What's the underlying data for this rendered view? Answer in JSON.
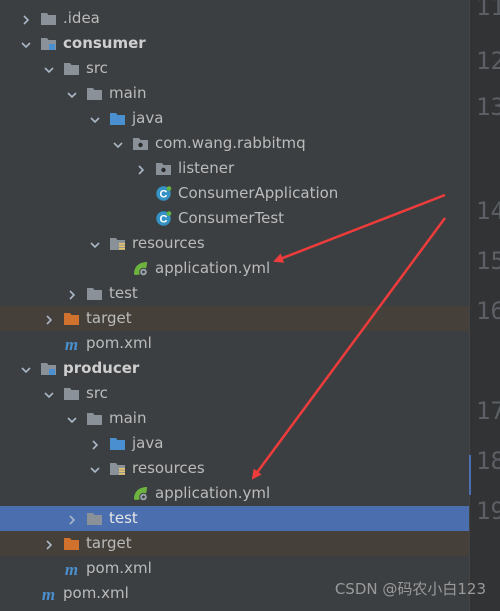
{
  "tree": [
    {
      "label": ".idea",
      "depth": 1,
      "arrow": "right",
      "icon": "folder-icon",
      "bold": false
    },
    {
      "label": "consumer",
      "depth": 1,
      "arrow": "down",
      "icon": "module-folder-icon",
      "bold": true
    },
    {
      "label": "src",
      "depth": 2,
      "arrow": "down",
      "icon": "folder-icon",
      "bold": false
    },
    {
      "label": "main",
      "depth": 3,
      "arrow": "down",
      "icon": "folder-icon",
      "bold": false
    },
    {
      "label": "java",
      "depth": 4,
      "arrow": "down",
      "icon": "source-folder-icon",
      "bold": false
    },
    {
      "label": "com.wang.rabbitmq",
      "depth": 5,
      "arrow": "down",
      "icon": "package-icon",
      "bold": false
    },
    {
      "label": "listener",
      "depth": 6,
      "arrow": "right",
      "icon": "package-icon",
      "bold": false
    },
    {
      "label": "ConsumerApplication",
      "depth": 6,
      "arrow": "none",
      "icon": "java-class-icon",
      "bold": false
    },
    {
      "label": "ConsumerTest",
      "depth": 6,
      "arrow": "none",
      "icon": "java-class-icon",
      "bold": false
    },
    {
      "label": "resources",
      "depth": 4,
      "arrow": "down",
      "icon": "resources-folder-icon",
      "bold": false
    },
    {
      "label": "application.yml",
      "depth": 5,
      "arrow": "none",
      "icon": "spring-yml-icon",
      "bold": false
    },
    {
      "label": "test",
      "depth": 3,
      "arrow": "right",
      "icon": "folder-icon",
      "bold": false
    },
    {
      "label": "target",
      "depth": 2,
      "arrow": "right",
      "icon": "excluded-folder-icon",
      "bold": false,
      "highlight": "target"
    },
    {
      "label": "pom.xml",
      "depth": 2,
      "arrow": "none",
      "icon": "maven-icon",
      "bold": false
    },
    {
      "label": "producer",
      "depth": 1,
      "arrow": "down",
      "icon": "module-folder-icon",
      "bold": true
    },
    {
      "label": "src",
      "depth": 2,
      "arrow": "down",
      "icon": "folder-icon",
      "bold": false
    },
    {
      "label": "main",
      "depth": 3,
      "arrow": "down",
      "icon": "folder-icon",
      "bold": false
    },
    {
      "label": "java",
      "depth": 4,
      "arrow": "right",
      "icon": "source-folder-icon",
      "bold": false
    },
    {
      "label": "resources",
      "depth": 4,
      "arrow": "down",
      "icon": "resources-folder-icon",
      "bold": false
    },
    {
      "label": "application.yml",
      "depth": 5,
      "arrow": "none",
      "icon": "spring-yml-icon",
      "bold": false
    },
    {
      "label": "test",
      "depth": 3,
      "arrow": "right",
      "icon": "folder-icon",
      "bold": false,
      "highlight": "selected"
    },
    {
      "label": "target",
      "depth": 2,
      "arrow": "right",
      "icon": "excluded-folder-icon",
      "bold": false,
      "highlight": "target"
    },
    {
      "label": "pom.xml",
      "depth": 2,
      "arrow": "none",
      "icon": "maven-icon",
      "bold": false
    },
    {
      "label": "pom.xml",
      "depth": 1,
      "arrow": "none",
      "icon": "maven-icon",
      "bold": false
    }
  ],
  "gutter": {
    "lines": [
      "11",
      "12",
      "13",
      "14",
      "15",
      "16",
      "17",
      "18",
      "19"
    ]
  },
  "watermark": "CSDN @码农小白123",
  "colors": {
    "panel": "#3c3f41",
    "selected": "#4b6eaf",
    "excluded": "#45403a",
    "arrow": "#ee3b3b",
    "folder": "#8a9199",
    "source": "#4a8fcf",
    "target_folder": "#d0722d"
  }
}
